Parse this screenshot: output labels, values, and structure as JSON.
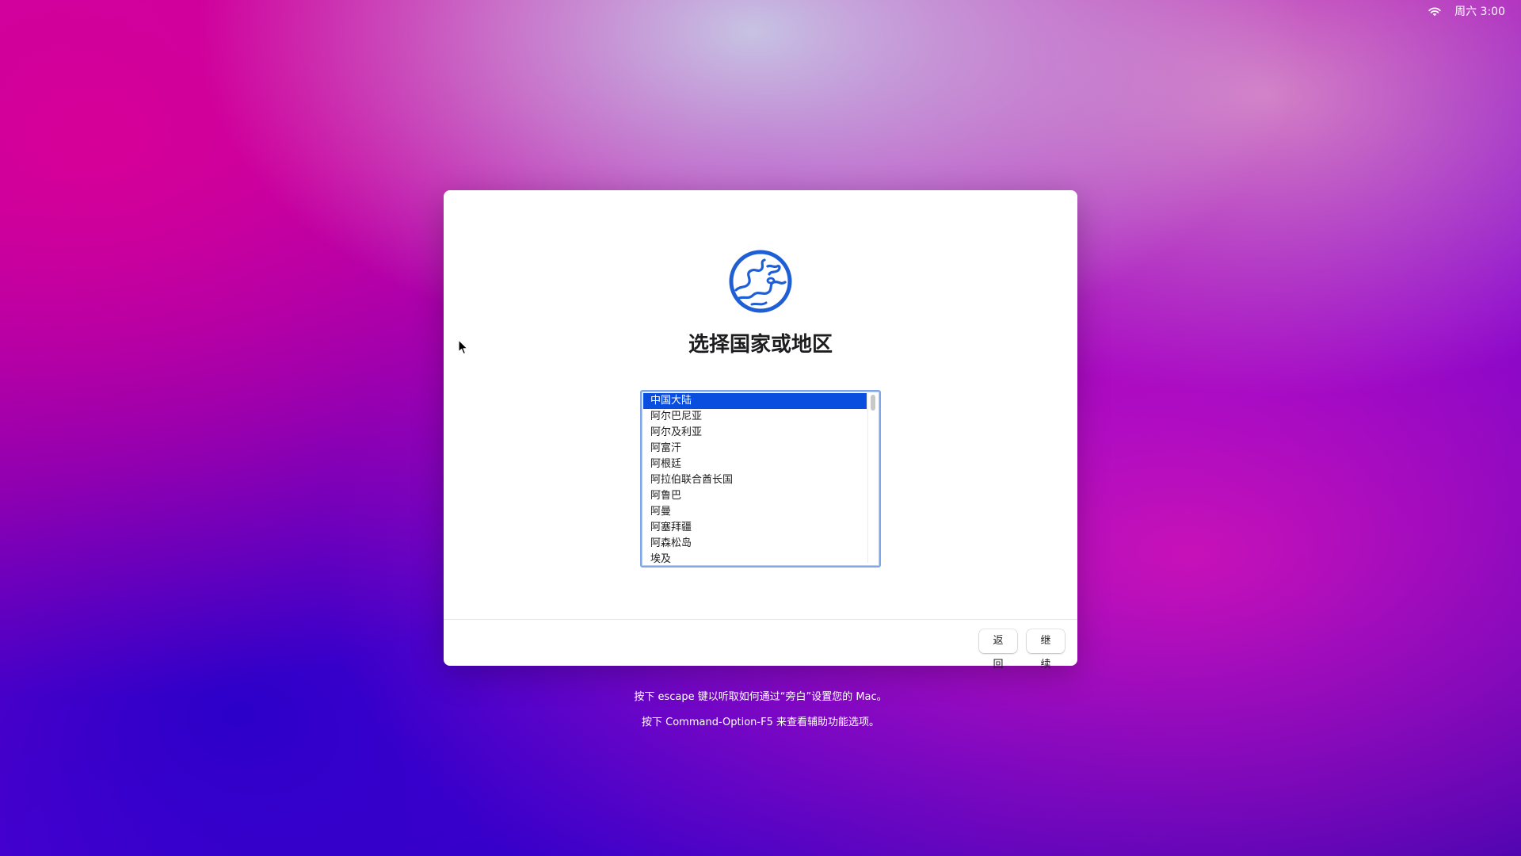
{
  "status_bar": {
    "wifi_icon": "wifi-icon",
    "clock": "周六 3:00"
  },
  "dialog": {
    "icon": "globe-icon",
    "title": "选择国家或地区",
    "accent_color": "#0a4ee0",
    "list": {
      "selected_index": 0,
      "items": [
        "中国大陆",
        "阿尔巴尼亚",
        "阿尔及利亚",
        "阿富汗",
        "阿根廷",
        "阿拉伯联合酋长国",
        "阿鲁巴",
        "阿曼",
        "阿塞拜疆",
        "阿森松岛",
        "埃及"
      ]
    },
    "buttons": {
      "back_label": "返回",
      "continue_label": "继续"
    }
  },
  "hints": {
    "line1": "按下 escape 键以听取如何通过“旁白”设置您的 Mac。",
    "line2": "按下 Command-Option-F5 来查看辅助功能选项。"
  }
}
